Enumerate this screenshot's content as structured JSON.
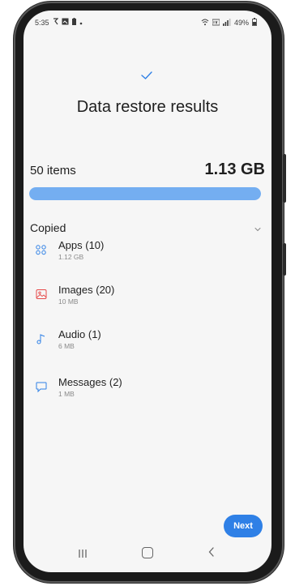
{
  "status_bar": {
    "time": "5:35",
    "battery": "49%"
  },
  "title": "Data restore results",
  "summary": {
    "items": "50 items",
    "size": "1.13 GB",
    "progress": 1.0
  },
  "section": {
    "title": "Copied"
  },
  "categories": [
    {
      "name": "Apps (10)",
      "size": "1.12 GB",
      "icon": "apps-icon"
    },
    {
      "name": "Images (20)",
      "size": "10 MB",
      "icon": "image-icon"
    },
    {
      "name": "Audio (1)",
      "size": "6 MB",
      "icon": "music-note-icon"
    },
    {
      "name": "Messages (2)",
      "size": "1 MB",
      "icon": "message-icon"
    }
  ],
  "actions": {
    "next": "Next"
  },
  "colors": {
    "accent": "#2f80e6",
    "progress": "#74aef1",
    "images_icon": "#e64a4a"
  }
}
